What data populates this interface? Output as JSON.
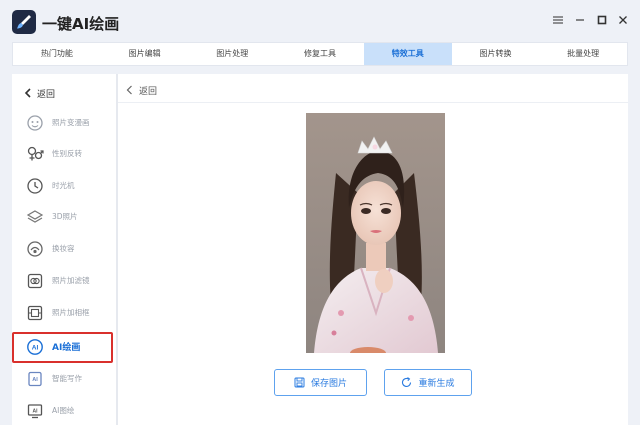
{
  "app": {
    "title": "一键AI绘画"
  },
  "tabs": [
    {
      "label": "热门功能",
      "active": false
    },
    {
      "label": "图片编辑",
      "active": false
    },
    {
      "label": "图片处理",
      "active": false
    },
    {
      "label": "修复工具",
      "active": false
    },
    {
      "label": "特效工具",
      "active": true
    },
    {
      "label": "图片转换",
      "active": false
    },
    {
      "label": "批量处理",
      "active": false
    }
  ],
  "sidebar": {
    "back_label": "返回",
    "items": [
      {
        "label": "照片变漫画",
        "icon": "face-icon"
      },
      {
        "label": "性别反转",
        "icon": "gender-icon"
      },
      {
        "label": "时光机",
        "icon": "clock-icon"
      },
      {
        "label": "3D照片",
        "icon": "layers-icon"
      },
      {
        "label": "换妆容",
        "icon": "makeup-icon"
      },
      {
        "label": "照片加滤镜",
        "icon": "filter-icon"
      },
      {
        "label": "照片加相框",
        "icon": "frame-icon"
      },
      {
        "label": "AI绘画",
        "icon": "ai-paint-icon",
        "active": true
      },
      {
        "label": "智能写作",
        "icon": "ai-write-icon"
      },
      {
        "label": "AI图绘",
        "icon": "ai-image-icon"
      }
    ]
  },
  "main": {
    "back_label": "返回",
    "buttons": {
      "save": "保存图片",
      "regenerate": "重新生成"
    }
  },
  "colors": {
    "accent": "#1a6fd6",
    "active_tab_bg": "#c9e0fa",
    "highlight": "#d9302c"
  }
}
